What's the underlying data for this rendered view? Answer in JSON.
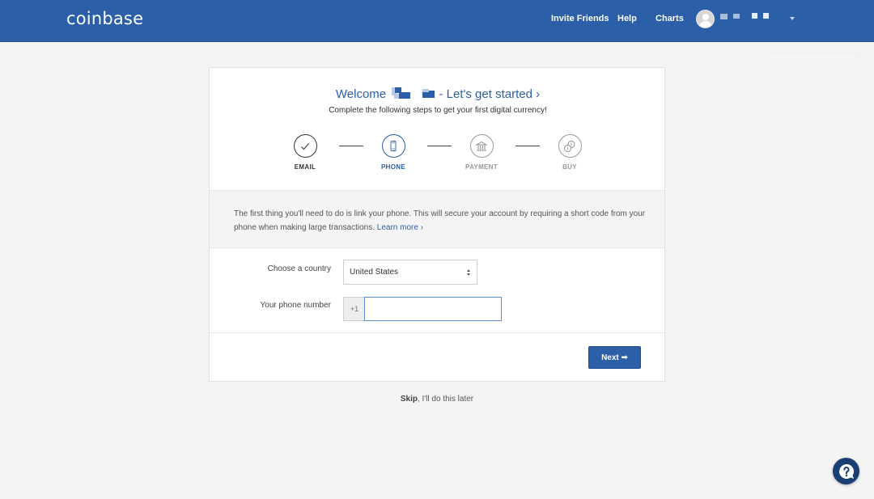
{
  "header": {
    "logo": "coinbase",
    "nav": [
      "Invite Friends",
      "Help",
      "Charts"
    ]
  },
  "welcome": {
    "prefix": "Welcome",
    "suffix": "- Let's get started ›",
    "subtitle": "Complete the following steps to get your first digital currency!"
  },
  "steps": [
    {
      "label": "EMAIL",
      "icon": "checkmark-icon",
      "state": "done"
    },
    {
      "label": "PHONE",
      "icon": "phone-icon",
      "state": "active"
    },
    {
      "label": "PAYMENT",
      "icon": "bank-icon",
      "state": "pending"
    },
    {
      "label": "BUY",
      "icon": "coins-icon",
      "state": "pending"
    }
  ],
  "info": {
    "text": "The first thing you'll need to do is link your phone. This will secure your account by requiring a short code from your phone when making large transactions.",
    "link": "Learn more ›"
  },
  "form": {
    "country_label": "Choose a country",
    "country_value": "United States",
    "phone_label": "Your phone number",
    "phone_prefix": "+1",
    "phone_value": ""
  },
  "actions": {
    "next_label": "Next ➡",
    "skip_bold": "Skip",
    "skip_rest": ", I'll do this later"
  },
  "colors": {
    "brand": "#2b5fa8",
    "help_button": "#1a3f72"
  }
}
